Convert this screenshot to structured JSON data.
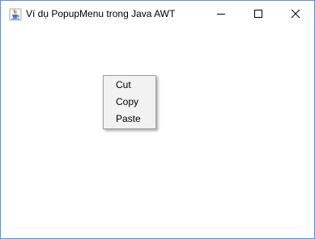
{
  "window": {
    "title": "Ví dụ PopupMenu trong Java AWT",
    "icon": "java-coffee-icon",
    "controls": {
      "minimize": "minimize-icon",
      "maximize": "maximize-icon",
      "close": "close-icon"
    }
  },
  "popup_menu": {
    "items": [
      {
        "label": "Cut"
      },
      {
        "label": "Copy"
      },
      {
        "label": "Paste"
      }
    ]
  },
  "colors": {
    "window_border": "#5a8fd6",
    "menu_background": "#f2f2f2",
    "menu_border": "#a0a0a0"
  }
}
